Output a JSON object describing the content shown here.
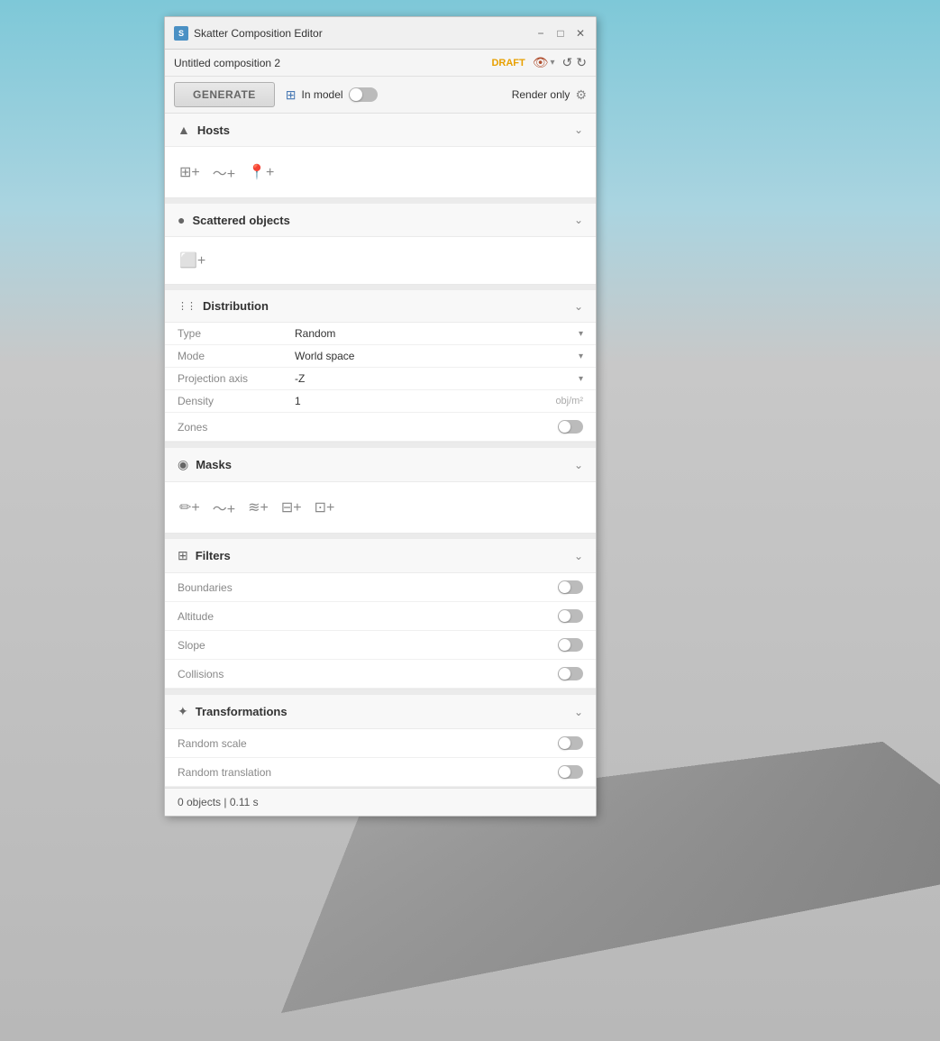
{
  "background": {
    "color_top": "#7ec8d8",
    "color_bottom": "#b8b8b8"
  },
  "dialog": {
    "title": "Skatter Composition Editor",
    "minimize_label": "−",
    "restore_label": "□",
    "close_label": "✕",
    "composition_name": "Untitled composition 2",
    "draft_badge": "DRAFT",
    "generate_button": "GENERATE",
    "in_model_label": "In model",
    "render_only_label": "Render only",
    "toggle_state": "off"
  },
  "sections": {
    "hosts": {
      "title": "Hosts",
      "icon": "▲",
      "chevron": "⌄"
    },
    "scattered_objects": {
      "title": "Scattered objects",
      "icon": "●",
      "chevron": "⌄"
    },
    "distribution": {
      "title": "Distribution",
      "icon": "⋮⋮",
      "chevron": "⌄",
      "fields": [
        {
          "label": "Type",
          "value": "Random",
          "type": "select"
        },
        {
          "label": "Mode",
          "value": "World space",
          "type": "select"
        },
        {
          "label": "Projection axis",
          "value": "-Z",
          "type": "select"
        },
        {
          "label": "Density",
          "value": "1",
          "unit": "obj/m²",
          "type": "input"
        }
      ],
      "zones_label": "Zones",
      "zones_toggle": "off"
    },
    "masks": {
      "title": "Masks",
      "icon": "◉",
      "chevron": "⌄"
    },
    "filters": {
      "title": "Filters",
      "icon": "⊞",
      "chevron": "⌄",
      "toggles": [
        {
          "label": "Boundaries",
          "state": "off"
        },
        {
          "label": "Altitude",
          "state": "off"
        },
        {
          "label": "Slope",
          "state": "off"
        },
        {
          "label": "Collisions",
          "state": "off"
        }
      ]
    },
    "transformations": {
      "title": "Transformations",
      "icon": "✦",
      "chevron": "⌄",
      "toggles": [
        {
          "label": "Random scale",
          "state": "off"
        },
        {
          "label": "Random translation",
          "state": "off"
        }
      ]
    }
  },
  "status_bar": {
    "text": "0 objects | 0.11 s"
  }
}
